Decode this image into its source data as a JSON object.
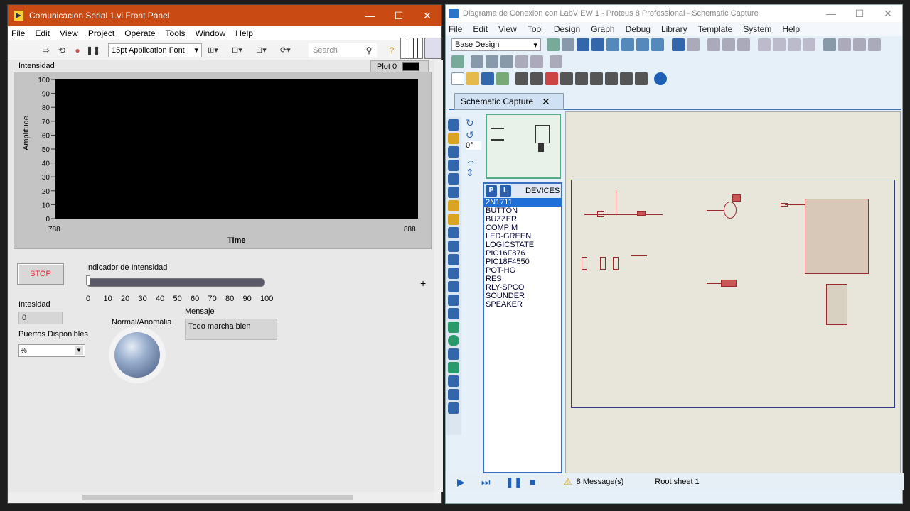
{
  "labview": {
    "title": "Comunicacion Serial 1.vi Front Panel",
    "menu": [
      "File",
      "Edit",
      "View",
      "Project",
      "Operate",
      "Tools",
      "Window",
      "Help"
    ],
    "font_select": "15pt Application Font",
    "search_placeholder": "Search",
    "chart": {
      "label": "Intensidad",
      "legend": "Plot 0",
      "xlabel": "Time",
      "ylabel": "Amplitude",
      "y_ticks": [
        "100",
        "90",
        "80",
        "70",
        "60",
        "50",
        "40",
        "30",
        "20",
        "10",
        "0"
      ],
      "x_min_label": "788",
      "x_max_label": "888"
    },
    "stop_label": "STOP",
    "slider": {
      "label": "Indicador de Intensidad",
      "ticks": [
        "0",
        "10",
        "20",
        "30",
        "40",
        "50",
        "60",
        "70",
        "80",
        "90",
        "100"
      ],
      "value": 0
    },
    "intesidad_label": "Intesidad",
    "intesidad_value": "0",
    "puertos_label": "Puertos Disponibles",
    "puertos_value": "%",
    "led_label": "Normal/Anomalia",
    "mensaje_label": "Mensaje",
    "mensaje_value": "Todo marcha bien"
  },
  "proteus": {
    "title": "Diagrama de Conexion con LabVIEW 1 - Proteus 8 Professional - Schematic Capture",
    "menu": [
      "File",
      "Edit",
      "View",
      "Tool",
      "Design",
      "Graph",
      "Debug",
      "Library",
      "Template",
      "System",
      "Help"
    ],
    "design_select": "Base Design",
    "tab": "Schematic Capture",
    "rotation": "0°",
    "devices_title": "DEVICES",
    "devices": [
      "2N1711",
      "BUTTON",
      "BUZZER",
      "COMPIM",
      "LED-GREEN",
      "LOGICSTATE",
      "PIC16F876",
      "PIC18F4550",
      "POT-HG",
      "RES",
      "RLY-SPCO",
      "SOUNDER",
      "SPEAKER"
    ],
    "selected_device": "2N1711",
    "messages": "8 Message(s)",
    "root": "Root sheet 1"
  }
}
